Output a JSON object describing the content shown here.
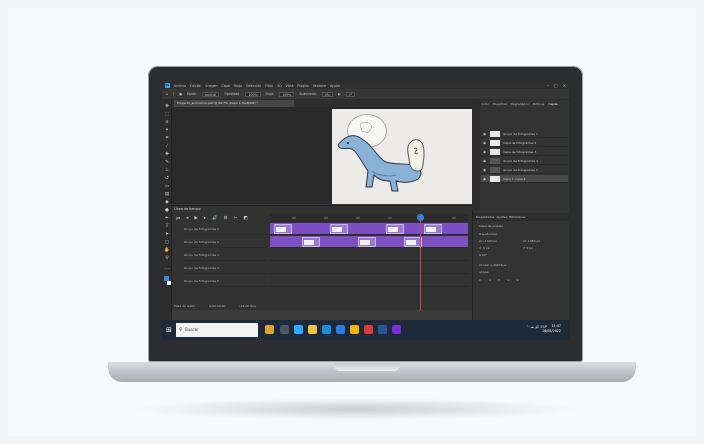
{
  "menubar": {
    "app_icon": "Ps",
    "items": [
      "Archivo",
      "Edición",
      "Imagen",
      "Capa",
      "Texto",
      "Selección",
      "Filtro",
      "3D",
      "Vista",
      "Plugins",
      "Ventana",
      "Ayuda"
    ]
  },
  "options": {
    "mode_label": "Modo:",
    "mode_value": "Normal",
    "opacity_label": "Opacidad:",
    "opacity_value": "100%",
    "flow_label": "Flujo:",
    "flow_value": "100%",
    "smoothing_label": "Suavizado:",
    "smoothing_value": "0%",
    "angle_value": "0°"
  },
  "document": {
    "tab": "Proyecto_animacion.psd @ 66,7% (Capa 1, RGB/8#) *"
  },
  "timeline": {
    "title": "Línea de tiempo",
    "ruler": [
      "00",
      "04",
      "08",
      "12",
      "16",
      "20"
    ],
    "tracks": [
      "Grupo de fotogramas 1",
      "Grupo de fotogramas 2",
      "Grupo de fotogramas 3",
      "Grupo de fotogramas 4",
      "Grupo de fotogramas 5"
    ],
    "footer_time": "0:00:00:00",
    "footer_fps": "(24,00 fps)",
    "footer_label": "Pista de audio"
  },
  "layers_panel": {
    "tabs": [
      "Color",
      "Muestras",
      "Degradados",
      "Motivos",
      "Capas"
    ],
    "rows": [
      "Grupo de fotogramas 1",
      "Capa de fotogramas 2",
      "Capa de fotogramas 3",
      "Grupo de fotogramas 4",
      "Grupo de fotogramas 5",
      "Capa 1 copia 2"
    ]
  },
  "properties": {
    "tabs": [
      "Propiedades",
      "Ajustes",
      "Bibliotecas"
    ],
    "section": "Capa de píxeles",
    "transform": "Transformar",
    "w": "An: 1920 px",
    "h": "Al: 1080 px",
    "x": "X: 0 px",
    "y": "Y: 0 px",
    "angle": "0,00°",
    "align": "Alinear y distribuir",
    "align_label": "Alinear:"
  },
  "taskbar": {
    "search_placeholder": "Buscar",
    "time": "11:47",
    "date": "16/08/2022",
    "tray": "^  ☁  🔊  ESP"
  },
  "colors": {
    "accent_purple": "#7c4fc2",
    "ps_blue": "#31a8ff"
  }
}
